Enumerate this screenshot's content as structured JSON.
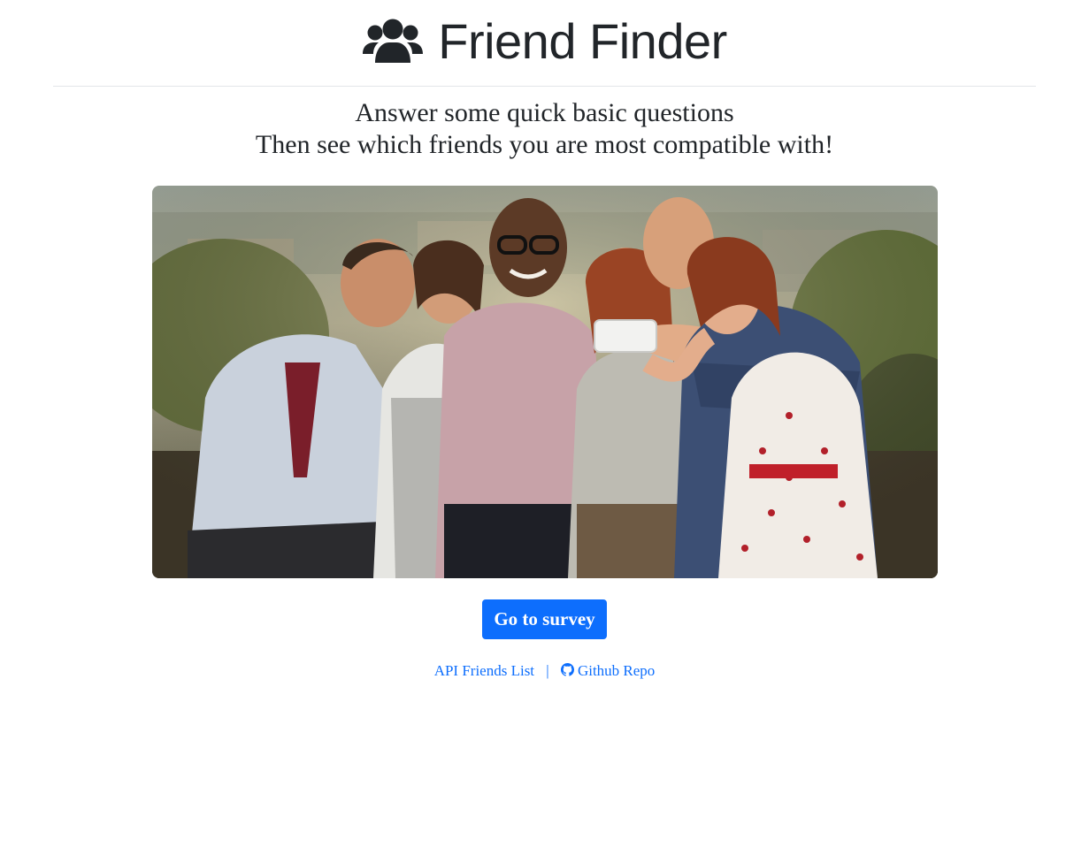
{
  "header": {
    "title": "Friend Finder",
    "icon": "users-icon"
  },
  "tagline": {
    "line1": "Answer some quick basic questions",
    "line2": "Then see which friends you are most compatible with!"
  },
  "hero": {
    "image": "group-of-friends-taking-selfie-photo"
  },
  "cta": {
    "label": "Go to survey"
  },
  "footer": {
    "api_link_label": "API Friends List",
    "separator": "|",
    "github_link_label": "Github Repo",
    "github_icon": "github-icon"
  },
  "colors": {
    "primary": "#0d6efd",
    "text": "#212529",
    "divider": "#e3e5e8"
  }
}
